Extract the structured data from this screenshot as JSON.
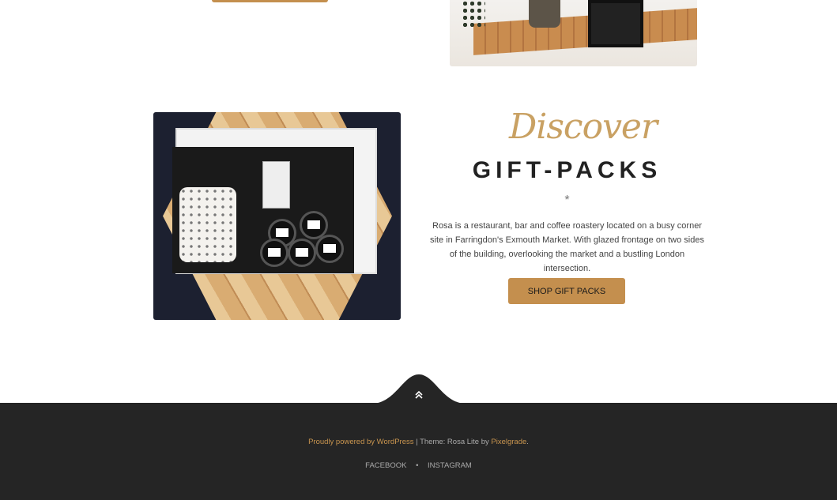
{
  "feature": {
    "script_label": "Discover",
    "title": "GIFT-PACKS",
    "separator": "*",
    "description": "Rosa is a restaurant, bar and coffee roastery located on a busy corner site in Farringdon's Exmouth Market. With glazed frontage on two sides of the building, overlooking the market and a bustling London intersection.",
    "button_label": "SHOP GIFT PACKS"
  },
  "footer": {
    "powered_by": "Proudly powered by WordPress",
    "separator": "|",
    "theme_text": "Theme: Rosa Lite by",
    "theme_author": "Pixelgrade",
    "period": ".",
    "social": [
      "FACEBOOK",
      "INSTAGRAM"
    ],
    "social_separator": "•",
    "back_to_top_icon": "chevron-double-up-icon"
  },
  "colors": {
    "accent": "#c48f4e",
    "footer_bg": "#252525",
    "script": "#c9a163"
  }
}
